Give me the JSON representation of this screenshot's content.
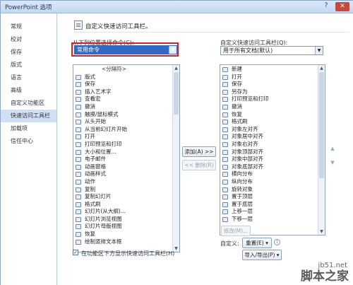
{
  "window": {
    "title": "PowerPoint 选项",
    "help": "?",
    "close": "✕"
  },
  "nav": {
    "items": [
      {
        "label": "常规"
      },
      {
        "label": "校对"
      },
      {
        "label": "保存"
      },
      {
        "label": "版式"
      },
      {
        "label": "语言"
      },
      {
        "label": "高级"
      },
      {
        "label": "自定义功能区"
      },
      {
        "label": "快速访问工具栏",
        "selected": true
      },
      {
        "label": "加载项"
      },
      {
        "label": "信任中心"
      }
    ]
  },
  "main": {
    "header": "自定义快速访问工具栏。",
    "choose_from_label": "从下列位置选择命令(C):",
    "choose_from_value": "常用命令",
    "customize_label": "自定义快速访问工具栏(Q):",
    "customize_value": "用于所有文档(默认)",
    "left_list": [
      {
        "label": "<分隔符>",
        "sep": true
      },
      {
        "label": "版式",
        "sub": "▶"
      },
      {
        "label": "保存"
      },
      {
        "label": "插入艺术字",
        "sub": "▶"
      },
      {
        "label": "查看宏"
      },
      {
        "label": "撤消",
        "sub": "▶"
      },
      {
        "label": "触摸/鼠标模式",
        "sub": "▶"
      },
      {
        "label": "从头开始"
      },
      {
        "label": "从当前幻灯片开始"
      },
      {
        "label": "打开"
      },
      {
        "label": "打印预览和打印"
      },
      {
        "label": "大小和位置..."
      },
      {
        "label": "电子邮件"
      },
      {
        "label": "动画窗格"
      },
      {
        "label": "动画样式",
        "sub": "▶"
      },
      {
        "label": "动作"
      },
      {
        "label": "复制"
      },
      {
        "label": "复制幻灯片"
      },
      {
        "label": "格式刷"
      },
      {
        "label": "幻灯片(从大纲)..."
      },
      {
        "label": "幻灯片浏览视图"
      },
      {
        "label": "幻灯片母版视图"
      },
      {
        "label": "恢复"
      },
      {
        "label": "绘制竖排文本框"
      }
    ],
    "right_list": [
      {
        "label": "新建"
      },
      {
        "label": "打开"
      },
      {
        "label": "保存"
      },
      {
        "label": "另存为"
      },
      {
        "label": "打印预览和打印"
      },
      {
        "label": "撤消",
        "sub": "▶"
      },
      {
        "label": "恢复"
      },
      {
        "label": "格式刷"
      },
      {
        "label": "对象左对齐"
      },
      {
        "label": "对象居中对齐"
      },
      {
        "label": "对象右对齐"
      },
      {
        "label": "对象顶部对齐"
      },
      {
        "label": "对象中部对齐"
      },
      {
        "label": "对象底部对齐"
      },
      {
        "label": "横向分布"
      },
      {
        "label": "纵向分布"
      },
      {
        "label": "旋转对象",
        "sub": "▶"
      },
      {
        "label": "置于顶层"
      },
      {
        "label": "置于底层"
      },
      {
        "label": "上移一层"
      },
      {
        "label": "下移一层"
      }
    ],
    "add_button": "添加(A) >>",
    "remove_button": "<< 删除(R)",
    "modify_button": "修改(M)...",
    "customize_label2": "自定义:",
    "reset_button": "重置(E) ▾",
    "import_export_button": "导入/导出(P) ▾",
    "show_below_ribbon": "在功能区下方显示快速访问工具栏(H)",
    "show_below_checked": "✓",
    "move_up": "▲",
    "move_down": "▼"
  },
  "watermark": {
    "site": "jb51.net",
    "brand": "脚本之家"
  }
}
